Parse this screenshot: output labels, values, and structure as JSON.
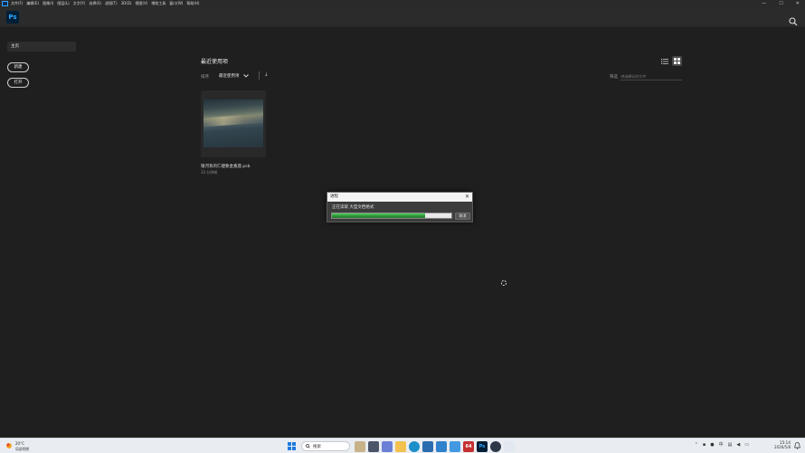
{
  "menubar": {
    "logo": "Ps",
    "items": [
      "文件(F)",
      "编辑(E)",
      "图像(I)",
      "图层(L)",
      "文字(Y)",
      "选择(S)",
      "滤镜(T)",
      "3D(D)",
      "视图(V)",
      "增效工具",
      "窗口(W)",
      "帮助(H)"
    ],
    "minimize": "—",
    "maximize": "☐",
    "close": "✕"
  },
  "header": {
    "logo": "Ps",
    "search_icon": "search-icon"
  },
  "sidebar": {
    "home": "主页",
    "new_label": "新建",
    "open_label": "打开"
  },
  "main": {
    "title": "最近使用项",
    "sort_label": "排序",
    "sort_value": "最近使用项",
    "sort_direction": "↓",
    "filter_label": "筛选",
    "filter_placeholder": "筛选最近的文件",
    "file": {
      "name": "银河系的仁捷象金素座.psb",
      "time": "33 分钟前"
    }
  },
  "dialog": {
    "title": "进程",
    "status": "正在读取 大型文档格式",
    "progress": 0.78,
    "cancel_label": "取消"
  },
  "taskbar": {
    "weather_temp": "20°C",
    "weather_desc": "局部阴朗",
    "search_label": "搜索",
    "time": "15:14",
    "date": "2026/5/8",
    "tray_ime": "中",
    "colors": {
      "accent": "#31a8ff",
      "progress": "#2f9a3a"
    }
  }
}
